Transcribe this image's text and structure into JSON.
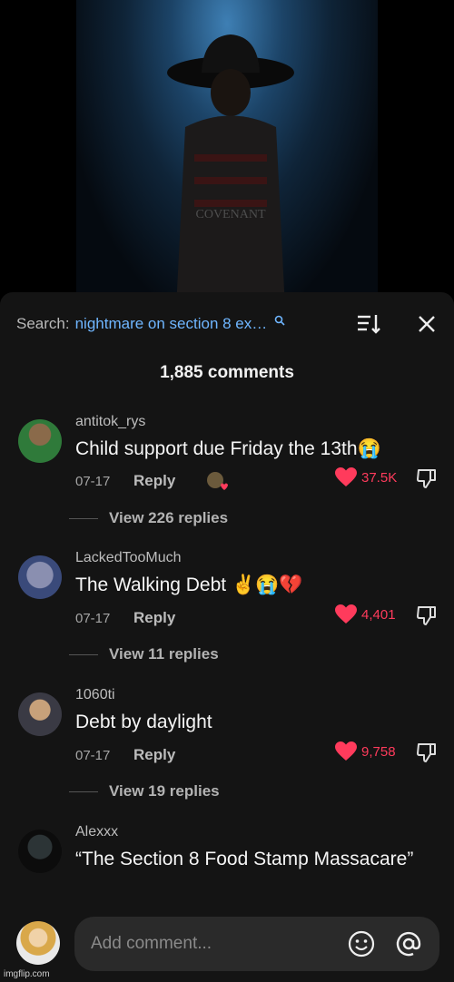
{
  "video": {
    "shirt_text": "COVENANT"
  },
  "header": {
    "search_label": "Search:",
    "search_query": "nightmare on section 8 ex…",
    "comment_count": "1,885 comments"
  },
  "comments": [
    {
      "username": "antitok_rys",
      "text": "Child support due Friday the 13th😭",
      "date": "07-17",
      "reply": "Reply",
      "likes": "37.5K",
      "view_replies": "View 226 replies"
    },
    {
      "username": "LackedTooMuch",
      "text": "The Walking Debt ✌️😭💔",
      "date": "07-17",
      "reply": "Reply",
      "likes": "4,401",
      "view_replies": "View 11 replies"
    },
    {
      "username": "1060ti",
      "text": "Debt by daylight",
      "date": "07-17",
      "reply": "Reply",
      "likes": "9,758",
      "view_replies": "View 19 replies"
    },
    {
      "username": "Alexxx",
      "text": "“The Section 8 Food Stamp Massacare”"
    }
  ],
  "input": {
    "placeholder": "Add comment..."
  },
  "watermark": "imgflip.com",
  "colors": {
    "like": "#ff3b5c",
    "link": "#6fb6ff",
    "sheet": "#141414"
  }
}
